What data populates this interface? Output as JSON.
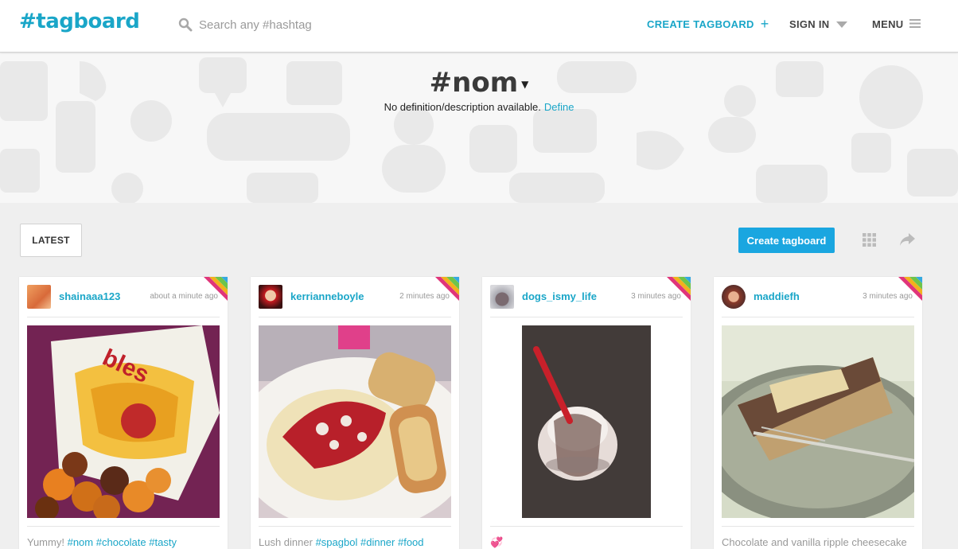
{
  "header": {
    "logo": "#tagboard",
    "search_placeholder": "Search any #hashtag",
    "create_label": "CREATE TAGBOARD",
    "signin_label": "SIGN IN",
    "menu_label": "MENU"
  },
  "hero": {
    "tag": "#nom",
    "description": "No definition/description available.",
    "define_link": "Define"
  },
  "toolbar": {
    "latest_label": "LATEST",
    "create_button": "Create tagboard"
  },
  "posts": [
    {
      "username": "shainaaa123",
      "time": "about a minute ago",
      "caption_text": "Yummy!",
      "hashtags": [
        "#nom",
        "#chocolate",
        "#tasty"
      ]
    },
    {
      "username": "kerrianneboyle",
      "time": "2 minutes ago",
      "caption_text": "Lush dinner",
      "hashtags": [
        "#spagbol",
        "#dinner",
        "#food"
      ]
    },
    {
      "username": "dogs_ismy_life",
      "time": "3 minutes ago",
      "caption_text": "💞",
      "hashtags": []
    },
    {
      "username": "maddiefh",
      "time": "3 minutes ago",
      "caption_text": "Chocolate and vanilla ripple cheesecake",
      "hashtags": []
    }
  ],
  "colors": {
    "brand": "#1aa6c8",
    "button": "#1aa6e0"
  }
}
